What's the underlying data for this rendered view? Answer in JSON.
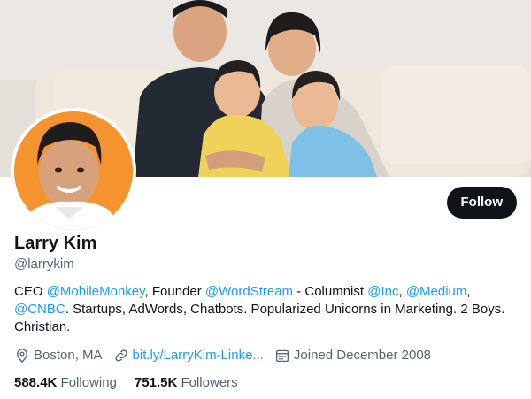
{
  "profile": {
    "name": "Larry Kim",
    "handle": "@larrykim",
    "follow_label": "Follow",
    "bio": {
      "t1": "CEO ",
      "m1": "@MobileMonkey",
      "t2": ", Founder ",
      "m2": "@WordStream",
      "t3": " - Columnist ",
      "m3": "@Inc",
      "t4": ", ",
      "m4": "@Medium",
      "t5": ", ",
      "m5": "@CNBC",
      "t6": ". Startups, AdWords, Chatbots. Popularized Unicorns in Marketing. 2 Boys. Christian."
    },
    "location": "Boston, MA",
    "website": "bit.ly/LarryKim-Linke...",
    "joined": "Joined December 2008",
    "following_count": "588.4K",
    "following_label": "Following",
    "followers_count": "751.5K",
    "followers_label": "Followers"
  },
  "icons": {
    "location": "location-pin-icon",
    "website": "link-icon",
    "joined": "calendar-icon"
  },
  "colors": {
    "accent": "#1d9bf0",
    "text": "#0f1419",
    "secondary_text": "#536471",
    "button_bg": "#0f1419",
    "avatar_bg": "#f5932e"
  }
}
